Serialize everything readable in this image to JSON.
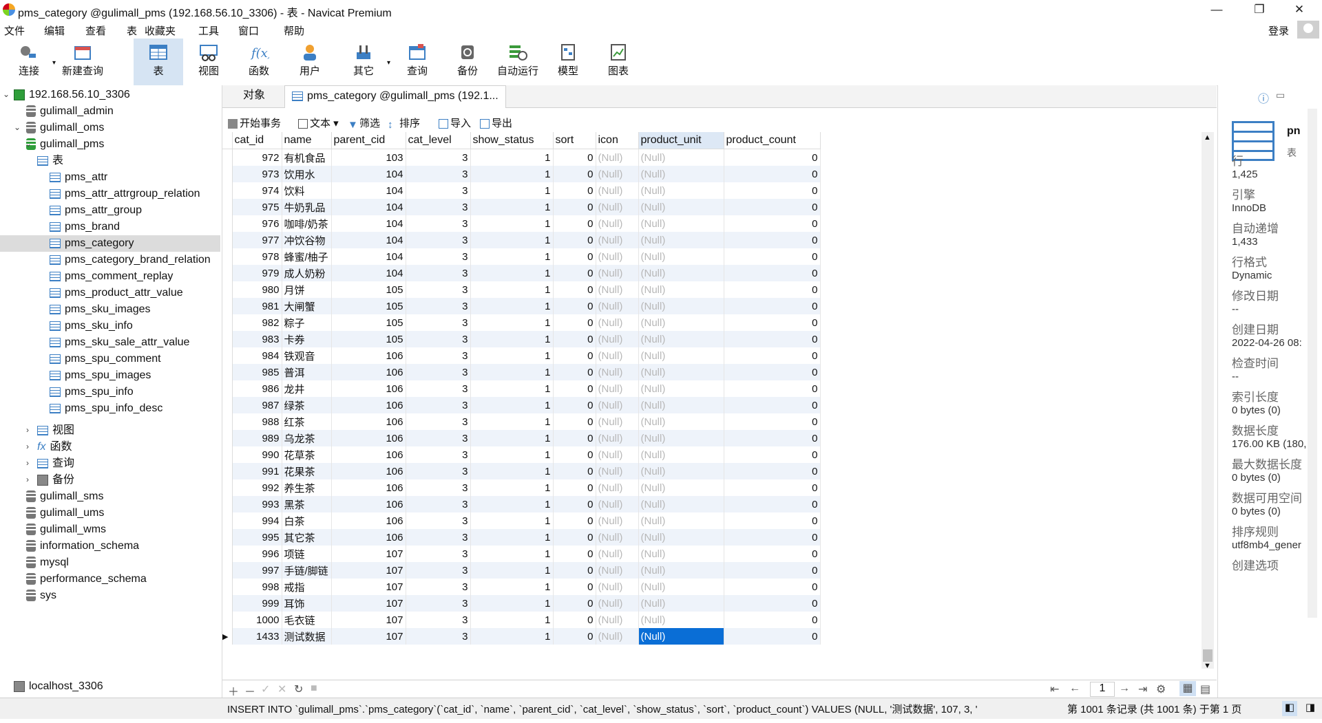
{
  "window": {
    "title": "pms_category @gulimall_pms (192.168.56.10_3306) - 表 - Navicat Premium",
    "min": "—",
    "max": "❐",
    "close": "✕"
  },
  "menu": [
    "文件",
    "编辑",
    "查看",
    "表",
    "收藏夹",
    "工具",
    "窗口",
    "帮助"
  ],
  "login": "登录",
  "toolbar": [
    {
      "label": "连接",
      "icon": "connection-icon"
    },
    {
      "label": "新建查询",
      "icon": "new-query-icon"
    },
    {
      "label": "表",
      "icon": "table-icon",
      "active": true
    },
    {
      "label": "视图",
      "icon": "view-icon"
    },
    {
      "label": "函数",
      "icon": "function-icon"
    },
    {
      "label": "用户",
      "icon": "user-icon"
    },
    {
      "label": "其它",
      "icon": "other-icon"
    },
    {
      "label": "查询",
      "icon": "query-icon"
    },
    {
      "label": "备份",
      "icon": "backup-icon"
    },
    {
      "label": "自动运行",
      "icon": "auto-run-icon"
    },
    {
      "label": "模型",
      "icon": "model-icon"
    },
    {
      "label": "图表",
      "icon": "chart-icon"
    }
  ],
  "tree": {
    "connection": "192.168.56.10_3306",
    "dbs_before": [
      "gulimall_admin",
      "gulimall_oms"
    ],
    "current_db": "gulimall_pms",
    "tables_label": "表",
    "tables": [
      "pms_attr",
      "pms_attr_attrgroup_relation",
      "pms_attr_group",
      "pms_brand",
      "pms_category",
      "pms_category_brand_relation",
      "pms_comment_replay",
      "pms_product_attr_value",
      "pms_sku_images",
      "pms_sku_info",
      "pms_sku_sale_attr_value",
      "pms_spu_comment",
      "pms_spu_images",
      "pms_spu_info",
      "pms_spu_info_desc"
    ],
    "selected_table": "pms_category",
    "other_nodes": [
      "视图",
      "函数",
      "查询",
      "备份"
    ],
    "dbs_after": [
      "gulimall_sms",
      "gulimall_ums",
      "gulimall_wms",
      "information_schema",
      "mysql",
      "performance_schema",
      "sys"
    ],
    "other_connection": "localhost_3306"
  },
  "tabs": {
    "objects": "对象",
    "current": "pms_category @gulimall_pms (192.1..."
  },
  "subtoolbar": {
    "begin_tx": "开始事务",
    "text": "文本",
    "filter": "筛选",
    "sort": "排序",
    "import": "导入",
    "export": "导出"
  },
  "grid": {
    "columns": [
      "cat_id",
      "name",
      "parent_cid",
      "cat_level",
      "show_status",
      "sort",
      "icon",
      "product_unit",
      "product_count"
    ],
    "rows": [
      [
        "972",
        "有机食品",
        "103",
        "3",
        "1",
        "0",
        "(Null)",
        "(Null)",
        "0"
      ],
      [
        "973",
        "饮用水",
        "104",
        "3",
        "1",
        "0",
        "(Null)",
        "(Null)",
        "0"
      ],
      [
        "974",
        "饮料",
        "104",
        "3",
        "1",
        "0",
        "(Null)",
        "(Null)",
        "0"
      ],
      [
        "975",
        "牛奶乳品",
        "104",
        "3",
        "1",
        "0",
        "(Null)",
        "(Null)",
        "0"
      ],
      [
        "976",
        "咖啡/奶茶",
        "104",
        "3",
        "1",
        "0",
        "(Null)",
        "(Null)",
        "0"
      ],
      [
        "977",
        "冲饮谷物",
        "104",
        "3",
        "1",
        "0",
        "(Null)",
        "(Null)",
        "0"
      ],
      [
        "978",
        "蜂蜜/柚子",
        "104",
        "3",
        "1",
        "0",
        "(Null)",
        "(Null)",
        "0"
      ],
      [
        "979",
        "成人奶粉",
        "104",
        "3",
        "1",
        "0",
        "(Null)",
        "(Null)",
        "0"
      ],
      [
        "980",
        "月饼",
        "105",
        "3",
        "1",
        "0",
        "(Null)",
        "(Null)",
        "0"
      ],
      [
        "981",
        "大闸蟹",
        "105",
        "3",
        "1",
        "0",
        "(Null)",
        "(Null)",
        "0"
      ],
      [
        "982",
        "粽子",
        "105",
        "3",
        "1",
        "0",
        "(Null)",
        "(Null)",
        "0"
      ],
      [
        "983",
        "卡券",
        "105",
        "3",
        "1",
        "0",
        "(Null)",
        "(Null)",
        "0"
      ],
      [
        "984",
        "铁观音",
        "106",
        "3",
        "1",
        "0",
        "(Null)",
        "(Null)",
        "0"
      ],
      [
        "985",
        "普洱",
        "106",
        "3",
        "1",
        "0",
        "(Null)",
        "(Null)",
        "0"
      ],
      [
        "986",
        "龙井",
        "106",
        "3",
        "1",
        "0",
        "(Null)",
        "(Null)",
        "0"
      ],
      [
        "987",
        "绿茶",
        "106",
        "3",
        "1",
        "0",
        "(Null)",
        "(Null)",
        "0"
      ],
      [
        "988",
        "红茶",
        "106",
        "3",
        "1",
        "0",
        "(Null)",
        "(Null)",
        "0"
      ],
      [
        "989",
        "乌龙茶",
        "106",
        "3",
        "1",
        "0",
        "(Null)",
        "(Null)",
        "0"
      ],
      [
        "990",
        "花草茶",
        "106",
        "3",
        "1",
        "0",
        "(Null)",
        "(Null)",
        "0"
      ],
      [
        "991",
        "花果茶",
        "106",
        "3",
        "1",
        "0",
        "(Null)",
        "(Null)",
        "0"
      ],
      [
        "992",
        "养生茶",
        "106",
        "3",
        "1",
        "0",
        "(Null)",
        "(Null)",
        "0"
      ],
      [
        "993",
        "黑茶",
        "106",
        "3",
        "1",
        "0",
        "(Null)",
        "(Null)",
        "0"
      ],
      [
        "994",
        "白茶",
        "106",
        "3",
        "1",
        "0",
        "(Null)",
        "(Null)",
        "0"
      ],
      [
        "995",
        "其它茶",
        "106",
        "3",
        "1",
        "0",
        "(Null)",
        "(Null)",
        "0"
      ],
      [
        "996",
        "项链",
        "107",
        "3",
        "1",
        "0",
        "(Null)",
        "(Null)",
        "0"
      ],
      [
        "997",
        "手链/脚链",
        "107",
        "3",
        "1",
        "0",
        "(Null)",
        "(Null)",
        "0"
      ],
      [
        "998",
        "戒指",
        "107",
        "3",
        "1",
        "0",
        "(Null)",
        "(Null)",
        "0"
      ],
      [
        "999",
        "耳饰",
        "107",
        "3",
        "1",
        "0",
        "(Null)",
        "(Null)",
        "0"
      ],
      [
        "1000",
        "毛衣链",
        "107",
        "3",
        "1",
        "0",
        "(Null)",
        "(Null)",
        "0"
      ],
      [
        "1433",
        "测试数据",
        "107",
        "3",
        "1",
        "0",
        "(Null)",
        "(Null)",
        "0"
      ]
    ]
  },
  "footer": {
    "page": "1",
    "sql": "INSERT INTO `gulimall_pms`.`pms_category`(`cat_id`, `name`, `parent_cid`, `cat_level`, `show_status`, `sort`, `product_count`) VALUES (NULL, '测试数据', 107, 3, '",
    "record": "第 1001 条记录 (共 1001 条) 于第 1 页"
  },
  "info": {
    "name": "pn",
    "type": "表",
    "fields": [
      {
        "label": "行",
        "value": "1,425"
      },
      {
        "label": "引擎",
        "value": "InnoDB"
      },
      {
        "label": "自动递增",
        "value": "1,433"
      },
      {
        "label": "行格式",
        "value": "Dynamic"
      },
      {
        "label": "修改日期",
        "value": "--"
      },
      {
        "label": "创建日期",
        "value": "2022-04-26 08:"
      },
      {
        "label": "检查时间",
        "value": "--"
      },
      {
        "label": "索引长度",
        "value": "0 bytes (0)"
      },
      {
        "label": "数据长度",
        "value": "176.00 KB (180,"
      },
      {
        "label": "最大数据长度",
        "value": "0 bytes (0)"
      },
      {
        "label": "数据可用空间",
        "value": "0 bytes (0)"
      },
      {
        "label": "排序规则",
        "value": "utf8mb4_gener"
      },
      {
        "label": "创建选项",
        "value": ""
      }
    ]
  },
  "colors": {
    "accent": "#0a6ed6",
    "selected_tab": "#d6e4f3",
    "alt_row": "#eef3fa"
  }
}
